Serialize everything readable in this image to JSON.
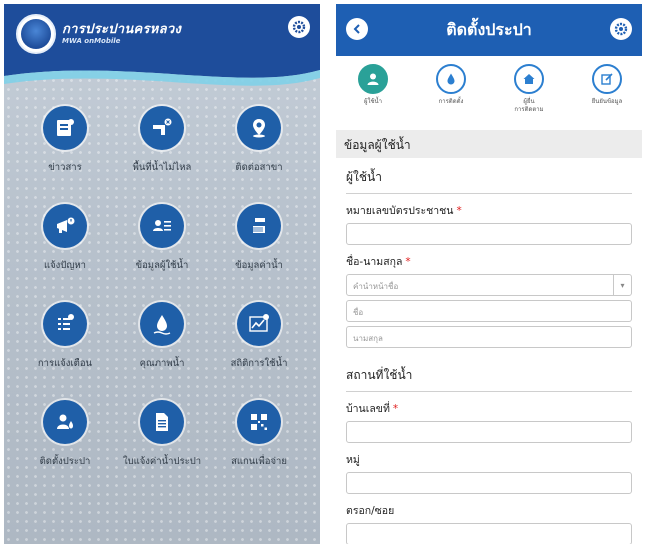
{
  "left_app": {
    "brand_title": "การประปานครหลวง",
    "brand_subtitle": "MWA onMobile",
    "menu": [
      {
        "label": "ข่าวสาร",
        "icon": "news-icon"
      },
      {
        "label": "พื้นที่น้ำไม่ไหล",
        "icon": "no-water-area-icon"
      },
      {
        "label": "ติดต่อสาขา",
        "icon": "branch-location-icon"
      },
      {
        "label": "แจ้งปัญหา",
        "icon": "report-problem-icon"
      },
      {
        "label": "ข้อมูลผู้ใช้น้ำ",
        "icon": "user-info-icon"
      },
      {
        "label": "ข้อมูลค่าน้ำ",
        "icon": "water-bill-icon"
      },
      {
        "label": "การแจ้งเตือน",
        "icon": "notification-icon"
      },
      {
        "label": "คุณภาพน้ำ",
        "icon": "water-quality-icon"
      },
      {
        "label": "สถิติการใช้น้ำ",
        "icon": "usage-stats-icon"
      },
      {
        "label": "ติดตั้งประปา",
        "icon": "install-water-icon"
      },
      {
        "label": "ใบแจ้งค่าน้ำประปา",
        "icon": "invoice-icon"
      },
      {
        "label": "สแกนเพื่อจ่าย",
        "icon": "qr-scan-icon"
      }
    ]
  },
  "right_app": {
    "title": "ติดตั้งประปา",
    "steps": [
      {
        "label": "ผู้ใช้น้ำ",
        "icon": "user-step-icon"
      },
      {
        "label": "การติดตั้ง",
        "icon": "water-drop-step-icon"
      },
      {
        "label": "ผู้ยื่น\nการติดตาม",
        "icon": "home-step-icon"
      },
      {
        "label": "ยืนยันข้อมูล",
        "icon": "edit-step-icon"
      }
    ],
    "section_title": "ข้อมูลผู้ใช้น้ำ",
    "subsection_user": "ผู้ใช้น้ำ",
    "id_label": "หมายเลขบัตรประชาชน",
    "id_value": "",
    "name_label": "ชื่อ-นามสกุล",
    "prefix_placeholder": "คำนำหน้าชื่อ",
    "first_name_placeholder": "ชื่อ",
    "last_name_placeholder": "นามสกุล",
    "subsection_location": "สถานที่ใช้น้ำ",
    "house_no_label": "บ้านเลขที่",
    "house_no_value": "",
    "moo_label": "หมู่",
    "moo_value": "",
    "soi_label": "ตรอก/ซอย",
    "soi_value": "",
    "required_mark": "*"
  },
  "colors": {
    "header_blue": "#1e4d9b",
    "right_header_blue": "#1e5fb3",
    "icon_blue": "#1f5fa8",
    "active_step": "#2aa198",
    "required_red": "#e02020"
  }
}
